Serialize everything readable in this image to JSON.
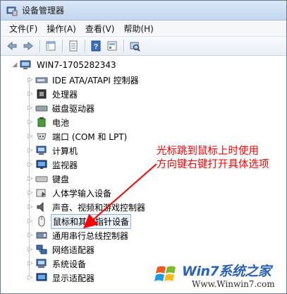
{
  "window": {
    "title": "设备管理器"
  },
  "menu": [
    "文件(F)",
    "操作(A)",
    "查看(V)",
    "帮助(H)"
  ],
  "toolbar": [
    "back-arrow-icon",
    "forward-arrow-icon",
    "console-tree-icon",
    "properties-icon",
    "help-icon",
    "update-driver-icon",
    "scan-hardware-icon"
  ],
  "tree": {
    "root": "WIN7-1705282343",
    "items": [
      {
        "label": "IDE ATA/ATAPI 控制器",
        "icon": "ide-controller-icon"
      },
      {
        "label": "处理器",
        "icon": "processor-icon"
      },
      {
        "label": "磁盘驱动器",
        "icon": "disk-drive-icon"
      },
      {
        "label": "电池",
        "icon": "battery-icon"
      },
      {
        "label": "端口 (COM 和 LPT)",
        "icon": "port-icon"
      },
      {
        "label": "计算机",
        "icon": "computer-icon"
      },
      {
        "label": "监视器",
        "icon": "monitor-icon"
      },
      {
        "label": "键盘",
        "icon": "keyboard-icon"
      },
      {
        "label": "人体学输入设备",
        "icon": "hid-icon"
      },
      {
        "label": "声音、视频和游戏控制器",
        "icon": "sound-icon"
      },
      {
        "label": "鼠标和其他指针设备",
        "icon": "mouse-icon"
      },
      {
        "label": "通用串行总线控制器",
        "icon": "usb-icon"
      },
      {
        "label": "网络适配器",
        "icon": "network-adapter-icon"
      },
      {
        "label": "系统设备",
        "icon": "system-device-icon"
      },
      {
        "label": "显示适配器",
        "icon": "display-adapter-icon"
      }
    ]
  },
  "annotation": {
    "line1": "光标跳到鼠标上时使用",
    "line2": "方向键右键打开具体选项"
  },
  "watermark": {
    "brand": "Win7系统之家",
    "url": "Www.Winwin7.com"
  },
  "colors": {
    "annotation": "#ff0000",
    "watermark": "#2a62b8",
    "selection": "#eaf2fb"
  }
}
